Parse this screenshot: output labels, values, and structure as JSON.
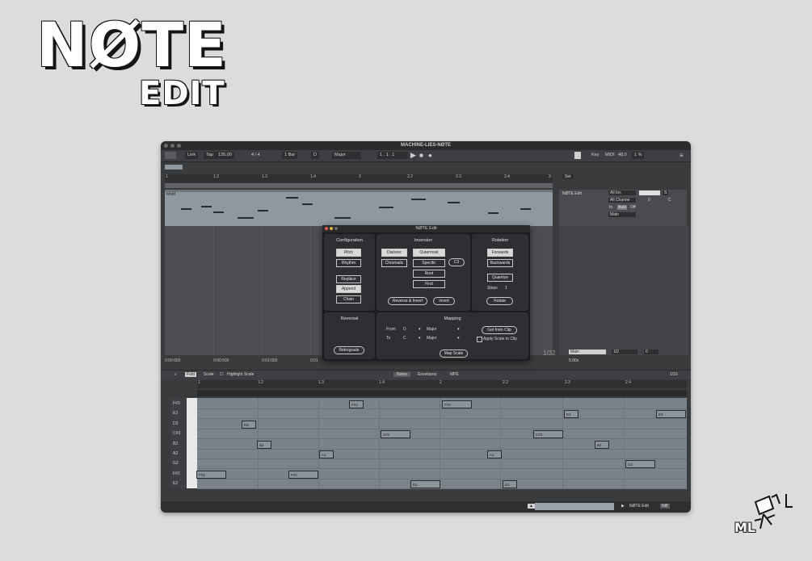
{
  "logo": {
    "title": "NØTE",
    "subtitle": "EDIT"
  },
  "window": {
    "title": "MACHINE-LIES-NØTE"
  },
  "toolbar": {
    "link": "Link",
    "tap": "Tap",
    "tempo": "135.00",
    "time_sig": "4 / 4",
    "quant": "1 Bar",
    "key_root": "D",
    "scale": "Major",
    "position": "1 . 1 . 1",
    "key": "Key",
    "midi": "MIDI",
    "cpu": "48.0",
    "percent": "1 %"
  },
  "ruler": {
    "ticks": [
      "1",
      "1.2",
      "1.3",
      "1.4",
      "2",
      "2.2",
      "2.3",
      "2.4",
      "3"
    ]
  },
  "clip": {
    "name": "Motif"
  },
  "right_panel": {
    "set_label": "Set",
    "device": "NØTE Edit",
    "input": "All Ins",
    "channel": "All Channe",
    "monitor_in": "In",
    "monitor_auto": "Auto",
    "monitor_off": "Off",
    "output": "Main",
    "s": "S",
    "vol": "0",
    "pan": "C"
  },
  "dialog": {
    "title": "NØTE Edit",
    "configuration": {
      "title": "Configuration",
      "pitch": "Pitch",
      "rhythm": "Rhythm",
      "replace": "Replace",
      "append": "Append",
      "chain": "Chain"
    },
    "inversion": {
      "title": "Inversion",
      "diatonic": "Diatonic",
      "chromatic": "Chromatic",
      "outermost": "Outermost",
      "specific": "Specific",
      "root": "Root",
      "first": "First",
      "note": "C3",
      "reverse_invert": "Reverse & Invert",
      "invert": "Invert"
    },
    "rotation": {
      "title": "Rotation",
      "forwards": "Forwards",
      "backwards": "Backwards",
      "quantize": "Quantize",
      "steps_label": "Steps",
      "steps_value": "1",
      "rotate": "Rotate"
    },
    "reversal": {
      "title": "Reversal",
      "retrograde": "Retrograde"
    },
    "mapping": {
      "title": "Mapping",
      "from_label": "From",
      "from_root": "D",
      "from_scale": "Major",
      "to_label": "To",
      "to_root": "C",
      "to_scale": "Major",
      "get_from_clip": "Get from Clip",
      "apply_scale": "Apply Scale to Clip",
      "map_scale": "Map Scale"
    }
  },
  "timeline": {
    "t0": "0:00:000",
    "t1": "0:00:500",
    "t2": "0:01:000",
    "t3": "0:01"
  },
  "status": {
    "fraction": "1/32",
    "main": "Main",
    "grid": "1/2",
    "zoom": "5.00x",
    "vol": "0"
  },
  "clip_editor": {
    "fold": "Fold",
    "scale": "Scale",
    "highlight": "Highlight Scale",
    "tab_notes": "Notes",
    "tab_envelopes": "Envelopes",
    "tab_mpe": "MPE",
    "grid": "1/16"
  },
  "rows": [
    "F#3",
    "E3",
    "D3",
    "C#3",
    "B2",
    "A2",
    "G2",
    "F#2",
    "E2"
  ],
  "notes": [
    {
      "label": "F#3"
    },
    {
      "label": "F#3"
    },
    {
      "label": "E3"
    },
    {
      "label": "E3"
    },
    {
      "label": "D3"
    },
    {
      "label": "C#3"
    },
    {
      "label": "C#3"
    },
    {
      "label": "B2"
    },
    {
      "label": "B2"
    },
    {
      "label": "A2"
    },
    {
      "label": "A2"
    },
    {
      "label": "G2"
    },
    {
      "label": "F#2"
    },
    {
      "label": "F#2"
    },
    {
      "label": "E2"
    },
    {
      "label": "E2"
    }
  ],
  "footer": {
    "device": "NØTE Edit",
    "short": "NØ"
  },
  "brand": {
    "mark": "ML"
  }
}
